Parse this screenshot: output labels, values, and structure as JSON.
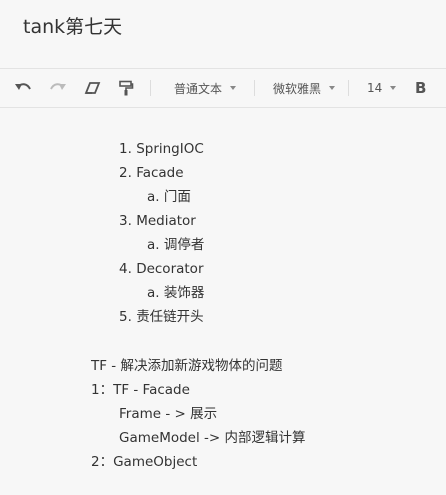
{
  "document": {
    "title": "tank第七天"
  },
  "toolbar": {
    "paragraph_style": "普通文本",
    "font_family": "微软雅黑",
    "font_size": "14",
    "bold_label": "B",
    "icons": [
      "undo-icon",
      "redo-icon",
      "eraser-icon",
      "format-painter-icon"
    ]
  },
  "content": {
    "ordered_list": [
      {
        "marker": "1.",
        "text": "SpringIOC"
      },
      {
        "marker": "2.",
        "text": "Facade",
        "sub": {
          "marker": "a.",
          "text": "门面"
        }
      },
      {
        "marker": "3.",
        "text": "Mediator",
        "sub": {
          "marker": "a.",
          "text": "调停者"
        }
      },
      {
        "marker": "4.",
        "text": "Decorator",
        "sub": {
          "marker": "a.",
          "text": "装饰器"
        }
      },
      {
        "marker": "5.",
        "text": "责任链开头"
      }
    ],
    "paragraphs": [
      "TF - 解决添加新游戏物体的问题",
      "1：TF - Facade",
      "Frame - > 展示",
      "GameModel -> 内部逻辑计算",
      "2：GameObject"
    ]
  }
}
